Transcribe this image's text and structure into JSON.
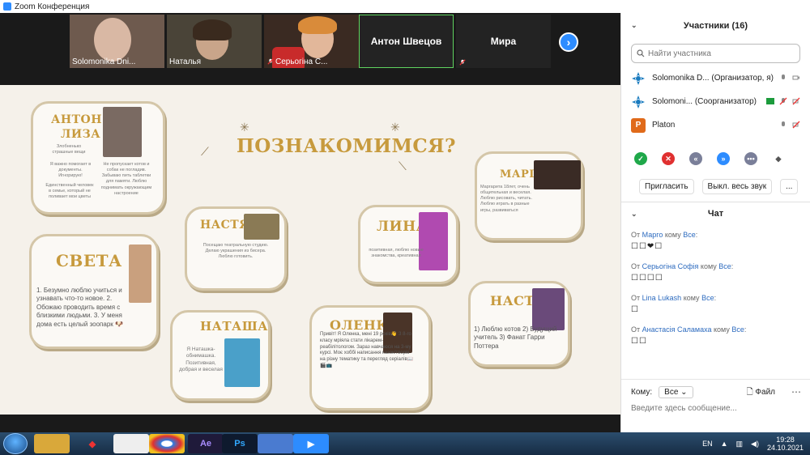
{
  "window": {
    "title": "Zoom Конференция"
  },
  "video_strip": {
    "tiles": [
      {
        "name": "Solomonika Dni..."
      },
      {
        "name": "Наталья"
      },
      {
        "name": "Серьогіна С..."
      },
      {
        "name": "Антон Швецов"
      },
      {
        "name": "Мира"
      }
    ]
  },
  "slide": {
    "title": "ПОЗНАКОМИМСЯ?",
    "cards": {
      "anton": {
        "title1": "АНТОН И",
        "title2": "ЛИЗА",
        "text1": "Злобненько страшные вещи",
        "text2": "Я важно помогает в документы. Игнорирую!",
        "text3": "Единственный человек в семье, который не поливает мои цветы",
        "text4": "Не пропускает котов и собак не погладив. Забываю пить таблетки для памяти. Люблю поднимать окружающим настроение"
      },
      "sveta": {
        "title": "СВЕТА",
        "text": "1. Безумно люблю учиться и узнавать что-то новое. 2. Обожаю проводить время с близкими людьми. 3. У меня дома есть целый зоопарк 🐶"
      },
      "nastya1": {
        "title": "НАСТЯ",
        "text": "Посещаю театральную студию. Делаю украшения из бисера. Люблю готовить."
      },
      "natasha": {
        "title": "НАТАША",
        "text": "Я Наташка-обнимашка. Позитивная, добрая и веселая"
      },
      "lina": {
        "title": "ЛИНА",
        "text": "позитивная, люблю новые знакомства, креативная"
      },
      "olenka": {
        "title": "ОЛЕНКА",
        "text": "Привіт! Я Оленка, мені 19 років👋 З 8-го класу мріяла стати лікарем-реабілітологом. Зараз навчаюся на 3-му курсі. Моє хоббі написання казок/творів на різну тематику та перегляд серіалів📖🎬📺"
      },
      "margo": {
        "title": "МАРГО",
        "text": "Маргарита 18лет, очень общительная и веселая. Люблю рисовать, читать. Люблю играть в разные игры, развиваться"
      },
      "nastya2": {
        "title": "НАСТЯ",
        "text": "1) Люблю котов 2) Будущий учитель 3) Фанат Гарри Поттера"
      }
    }
  },
  "participants_panel": {
    "title": "Участники (16)",
    "search_placeholder": "Найти участника",
    "participants": [
      {
        "name": "Solomonika D...",
        "role": "(Организатор, я)"
      },
      {
        "name": "Solomoni...",
        "role": "(Соорганизатор)"
      },
      {
        "name": "Platon",
        "role": ""
      }
    ],
    "invite_label": "Пригласить",
    "mute_all_label": "Выкл. весь звук",
    "more_label": "..."
  },
  "chat": {
    "title": "Чат",
    "messages": [
      {
        "prefix": "От",
        "sender": "Марго",
        "to_word": "кому",
        "recipient": "Все",
        "body": "☐☐❤☐"
      },
      {
        "prefix": "От",
        "sender": "Серьогіна Софія",
        "to_word": "кому",
        "recipient": "Все",
        "body": "☐☐☐☐"
      },
      {
        "prefix": "От",
        "sender": "Lina Lukash",
        "to_word": "кому",
        "recipient": "Все",
        "body": "☐"
      },
      {
        "prefix": "От",
        "sender": "Анастасія Саламаха",
        "to_word": "кому",
        "recipient": "Все",
        "body": "☐☐"
      }
    ],
    "to_label": "Кому:",
    "to_value": "Все",
    "file_label": "Файл",
    "input_placeholder": "Введите здесь сообщение..."
  },
  "taskbar": {
    "lang": "EN",
    "time": "19:28",
    "date": "24.10.2021",
    "apps": [
      "Ae",
      "Ps"
    ]
  },
  "colors": {
    "accent": "#2d8cff",
    "gold": "#c79a3d",
    "taskbar": "#1f3b57"
  }
}
